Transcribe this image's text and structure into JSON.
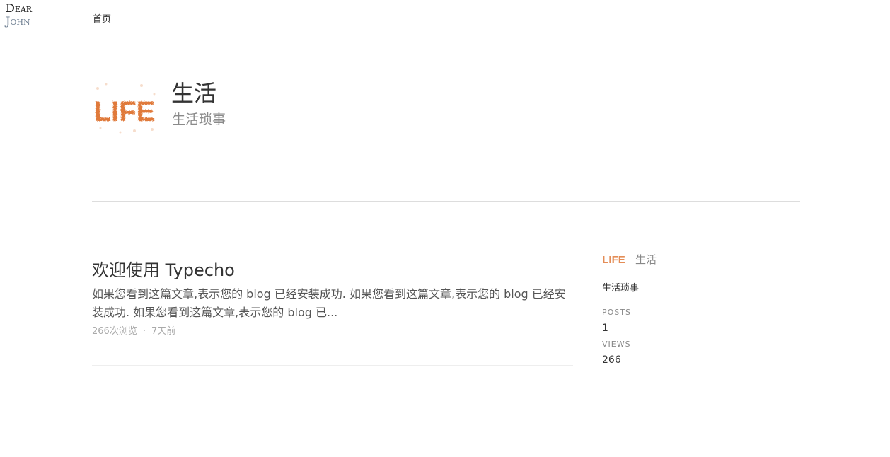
{
  "site": {
    "logo_line1": "Dear",
    "logo_line2": "John"
  },
  "nav": {
    "home_label": "首页"
  },
  "category": {
    "title": "生活",
    "description": "生活琐事",
    "image_text": "LIFE"
  },
  "posts": [
    {
      "title": "欢迎使用 Typecho",
      "excerpt": "如果您看到这篇文章,表示您的 blog 已经安装成功. 如果您看到这篇文章,表示您的 blog 已经安装成功. 如果您看到这篇文章,表示您的 blog 已...",
      "views": "266次浏览",
      "separator": "·",
      "date": "7天前"
    }
  ],
  "sidebar": {
    "name": "生活",
    "description": "生活琐事",
    "posts_label": "POSTS",
    "posts_count": "1",
    "views_label": "VIEWS",
    "views_count": "266"
  },
  "colors": {
    "accent_orange": "#e07a3a",
    "muted_text": "#aaaaaa",
    "logo_secondary": "#6f7f92"
  }
}
